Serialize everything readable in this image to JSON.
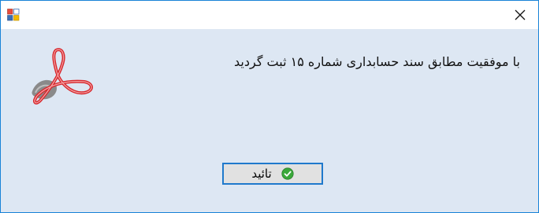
{
  "dialog": {
    "message": "با موفقیت مطابق سند حسابداری شماره ۱۵ ثبت گردید",
    "ok_label": "تائید"
  },
  "titlebar": {
    "close_glyph": "✕"
  },
  "colors": {
    "window_border": "#1883d7",
    "client_background": "#dde7f3",
    "button_border": "#1f79cc",
    "pdf_red": "#d7262b",
    "check_green": "#3aa83a"
  }
}
